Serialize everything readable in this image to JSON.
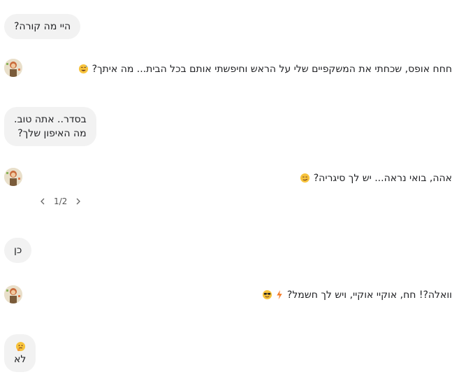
{
  "messages": {
    "user_1": "היי מה קורה?",
    "bot_1": "חחח אופס, שכחתי את המשקפיים שלי על הראש וחיפשתי אותם בכל הבית... מה איתך?",
    "user_2_line1": "בסדר.. אתה טוב.",
    "user_2_line2": "מה האיפון שלך?",
    "bot_2": "אהה, בואי נראה... יש לך סיגריה?",
    "user_3": "כן",
    "bot_3": "וואלה?! חח, אוקיי אוקיי, ויש לך חשמל?",
    "user_4": "לא"
  },
  "pager": {
    "label": "1/2"
  },
  "icons": {
    "bot_1_emoji": "grinning-sweat-emoji-icon",
    "bot_2_emoji": "smirking-face-emoji-icon",
    "bot_3_emoji_1": "sunglasses-face-emoji-icon",
    "bot_3_emoji_2": "lightning-bolt-icon",
    "user_4_emoji": "thinking-face-emoji-icon",
    "avatar": "character-avatar"
  },
  "colors": {
    "bubble_bg": "#f2f2f2",
    "text": "#202124",
    "emoji_yellow": "#f7c33c",
    "bolt_orange": "#f57c2a"
  }
}
